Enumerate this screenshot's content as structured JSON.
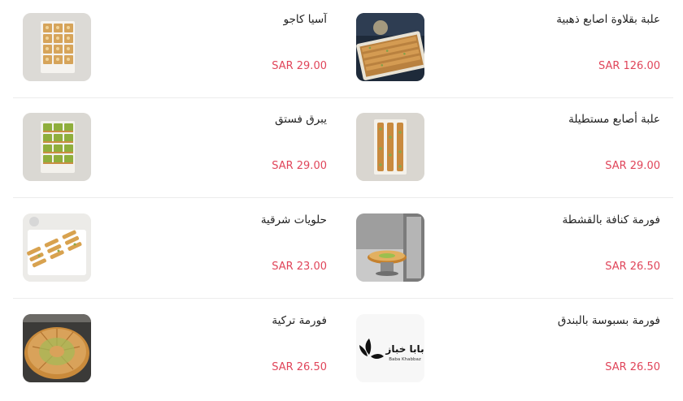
{
  "currency": "SAR",
  "products": [
    {
      "name": "علبة بقلاوة اصابع ذهبية",
      "price": "SAR 126.00",
      "image": "golden-baklava-fingers-box"
    },
    {
      "name": "آسيا كاجو",
      "price": "SAR 29.00",
      "image": "asia-cashew-tray"
    },
    {
      "name": "علبة أصابع مستطيلة",
      "price": "SAR 29.00",
      "image": "rectangular-fingers-box"
    },
    {
      "name": "يبرق فستق",
      "price": "SAR 29.00",
      "image": "pistachio-yabraq-tray"
    },
    {
      "name": "فورمة كنافة بالقشطة",
      "price": "SAR 26.50",
      "image": "kunafa-cream-round"
    },
    {
      "name": "حلويات شرقية",
      "price": "SAR 23.00",
      "image": "oriental-sweets-platter"
    },
    {
      "name": "فورمة بسبوسة بالبندق",
      "price": "SAR 26.50",
      "image": "baba-khabbaz-logo"
    },
    {
      "name": "فورمة تركية",
      "price": "SAR 26.50",
      "image": "turkish-round-pastry"
    }
  ],
  "logo": {
    "arabic": "بابا خباز",
    "latin": "Baba Khabbaz"
  }
}
